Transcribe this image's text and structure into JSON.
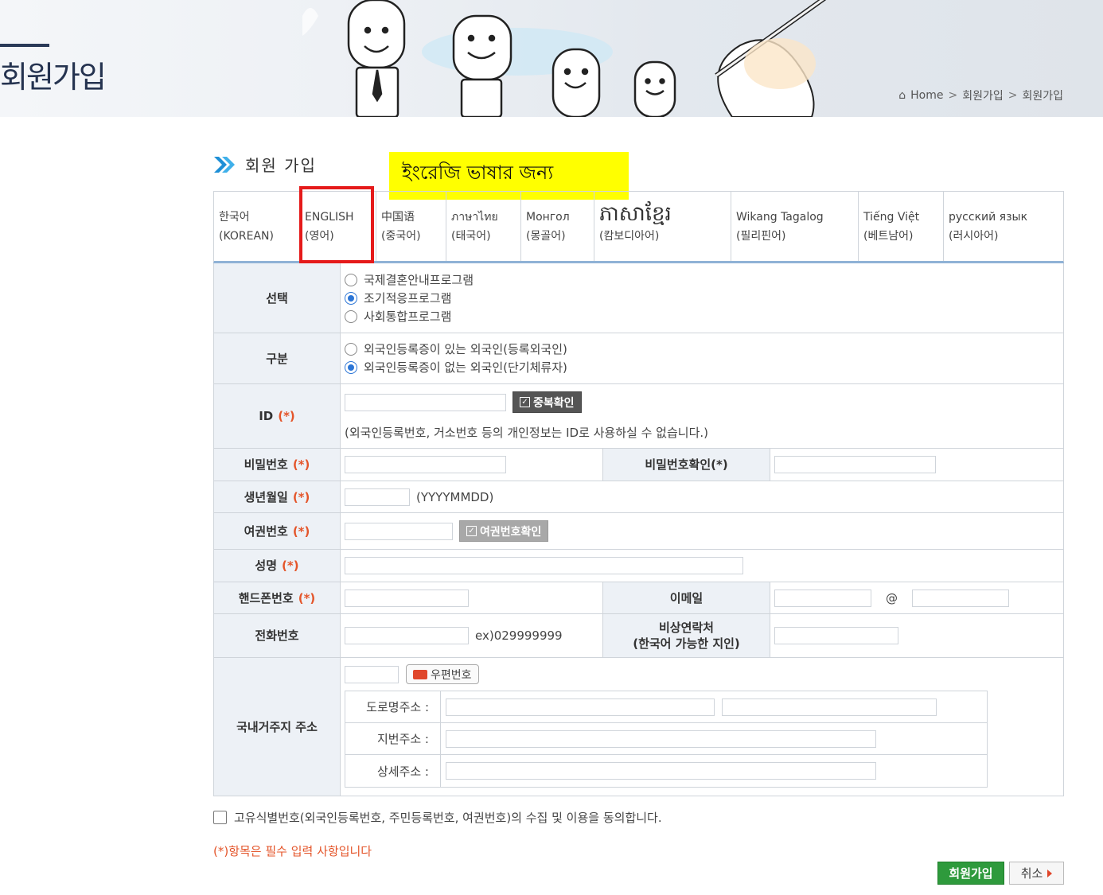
{
  "header": {
    "page_title": "회원가입",
    "breadcrumb": [
      "Home",
      "회원가입",
      "회원가입"
    ]
  },
  "section": {
    "title": "회원 가입",
    "annotation": "ইংরেজি ভাষার জন্য"
  },
  "languages": [
    {
      "line1": "한국어",
      "line2": "(KOREAN)"
    },
    {
      "line1": "ENGLISH",
      "line2": "(영어)"
    },
    {
      "line1": "中国语",
      "line2": "(중국어)"
    },
    {
      "line1": "ภาษาไทย",
      "line2": "(태국어)"
    },
    {
      "line1": "Монгол",
      "line2": "(몽골어)"
    },
    {
      "line1": "ភាសាខ្មែរ",
      "line2": "(캄보디아어)"
    },
    {
      "line1": "Wikang Tagalog",
      "line2": "(필리핀어)"
    },
    {
      "line1": "Tiếng Việt",
      "line2": "(베트남어)"
    },
    {
      "line1": "русский язык",
      "line2": "(러시아어)"
    }
  ],
  "form": {
    "required_mark": "(*)",
    "program": {
      "label": "선택",
      "options": [
        "국제결혼안내프로그램",
        "조기적응프로그램",
        "사회통합프로그램"
      ],
      "selected": 1
    },
    "category": {
      "label": "구분",
      "options": [
        "외국인등록증이 있는 외국인(등록외국인)",
        "외국인등록증이 없는 외국인(단기체류자)"
      ],
      "selected": 1
    },
    "id": {
      "label": "ID",
      "check_button": "중복확인",
      "note": "(외국인등록번호, 거소번호 등의 개인정보는 ID로 사용하실 수 없습니다.)"
    },
    "password": {
      "label": "비밀번호",
      "confirm_label": "비밀번호확인"
    },
    "birth": {
      "label": "생년월일",
      "format": "(YYYYMMDD)"
    },
    "passport": {
      "label": "여권번호",
      "check_button": "여권번호확인"
    },
    "name": {
      "label": "성명"
    },
    "phone": {
      "label": "핸드폰번호",
      "email_label": "이메일",
      "at": "@"
    },
    "tel": {
      "label": "전화번호",
      "example": "ex)029999999",
      "emergency_label_1": "비상연락처",
      "emergency_label_2": "(한국어 가능한 지인)"
    },
    "address": {
      "label": "국내거주지 주소",
      "zip_button": "우편번호",
      "road_label": "도로명주소 :",
      "jibun_label": "지번주소 :",
      "detail_label": "상세주소 :"
    }
  },
  "agree_text": "고유식별번호(외국인등록번호, 주민등록번호, 여권번호)의 수집 및 이용을 동의합니다.",
  "required_note": "(*)항목은 필수 입력 사항입니다",
  "buttons": {
    "join": "회원가입",
    "cancel": "취소"
  },
  "colors": {
    "accent_red": "#e51a1a",
    "required_orange": "#e4552a",
    "join_green": "#2e9a3c",
    "annotation_yellow": "#ffff00"
  }
}
